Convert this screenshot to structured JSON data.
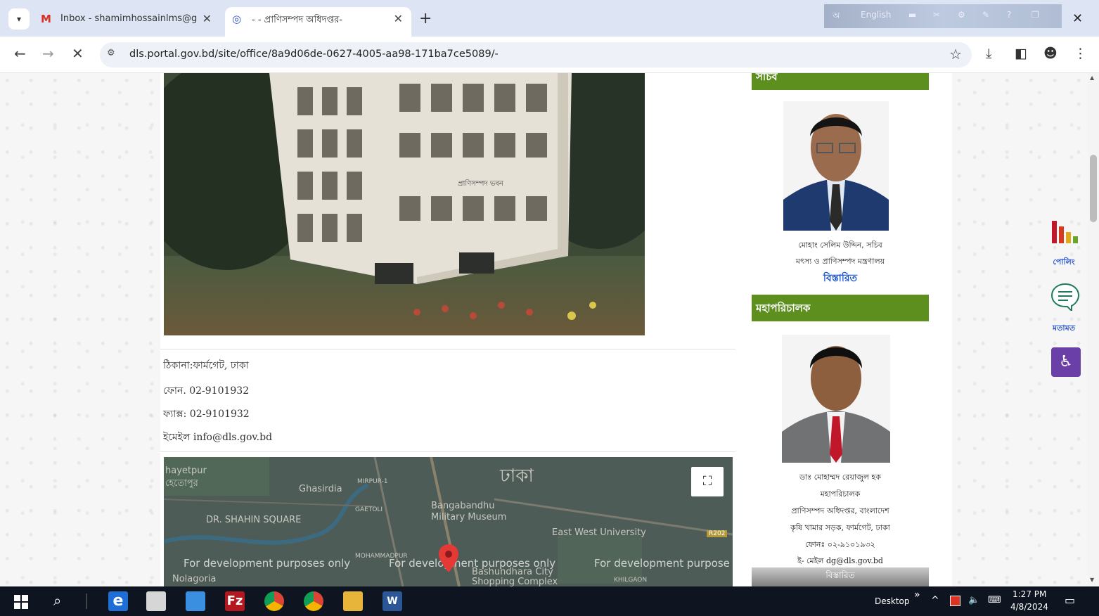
{
  "browser": {
    "tabs": [
      {
        "title": "Inbox - shamimhossainlms@gm",
        "active": false
      },
      {
        "title": "- - প্রাণিসম্পদ অধিদপ্তর-",
        "active": true
      }
    ],
    "tray_language": "English",
    "url": "dls.portal.gov.bd/site/office/8a9d06de-0627-4005-aa98-171ba7ce5089/-"
  },
  "page": {
    "building_sign": "প্রাণিসম্পদ ভবন",
    "contact": {
      "address": "ঠিকানা:ফার্মগেট, ঢাকা",
      "phone": "ফোন. 02-9101932",
      "fax": "ফ্যাক্স: 02-9101932",
      "email": "ইমেইল info@dls.gov.bd"
    },
    "map": {
      "labels": [
        "hayetpur",
        "হেতোপুর",
        "Ghasirdia",
        "MIRPUR-1",
        "GAETOLI",
        "DR. SHAHIN SQUARE",
        "Bangabandhu",
        "Military Museum",
        "ঢাকা",
        "East West University",
        "MOHAMMADPUR",
        "Bashundhara City",
        "Shopping Complex",
        "KHILGAON",
        "Nolagoria",
        "R202"
      ],
      "watermark": [
        "For development purposes only",
        "For development purposes only",
        "For development purpose"
      ]
    },
    "sidebar": {
      "secretary_header": "সচিব",
      "secretary_name": "মোহাং সেলিম উদ্দিন, সচিব",
      "secretary_ministry": "মৎস্য ও প্রাণিসম্পদ মন্ত্রণালয়",
      "secretary_link": "বিস্তারিত",
      "dg_header": "মহাপরিচালক",
      "dg_name": "ডাঃ মোহাম্মদ রেয়াজুল হক",
      "dg_title": "মহাপরিচালক",
      "dg_office": "প্রাণিসম্পদ অধিদপ্তর, বাংলাদেশ",
      "dg_address": "কৃষি খামার সড়ক, ফার্মগেট, ঢাকা",
      "dg_phone": "ফোনঃ ০২-৯১০১৯৩২",
      "dg_email": "ই- মেইল dg@dls.gov.bd",
      "dg_more": "বিস্তারিত"
    },
    "floating": {
      "poll_label": "পোলিং",
      "feedback_label": "মতামত"
    }
  },
  "taskbar": {
    "desktop_label": "Desktop",
    "time": "1:27 PM",
    "date": "4/8/2024"
  }
}
